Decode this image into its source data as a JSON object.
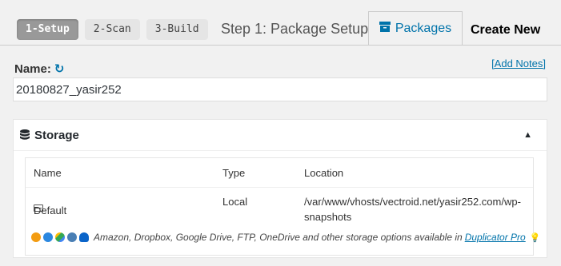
{
  "steps": [
    {
      "label": "1-Setup",
      "active": true
    },
    {
      "label": "2-Scan",
      "active": false
    },
    {
      "label": "3-Build",
      "active": false
    }
  ],
  "step_title": "Step 1: Package Setup",
  "tabs": {
    "packages_label": "Packages",
    "create_new_label": "Create New"
  },
  "name_section": {
    "label": "Name:",
    "add_notes": "[Add Notes]",
    "value": "20180827_yasir252"
  },
  "storage": {
    "title": "Storage",
    "columns": [
      "Name",
      "Type",
      "Location"
    ],
    "rows": [
      {
        "name": "Default",
        "type": "Local",
        "location": "/var/www/vhosts/vectroid.net/yasir252.com/wp-snapshots"
      }
    ],
    "promo_text": "Amazon, Dropbox, Google Drive, FTP, OneDrive and other storage options available in",
    "promo_link": "Duplicator Pro",
    "promo_icons": [
      {
        "name": "amazon-icon",
        "color": "#f39c12"
      },
      {
        "name": "dropbox-icon",
        "color": "#2c88e0"
      },
      {
        "name": "google-drive-icon",
        "color": "#34a853"
      },
      {
        "name": "ftp-icon",
        "color": "#4a7fb5"
      },
      {
        "name": "onedrive-icon",
        "color": "#0a64c9"
      }
    ]
  },
  "colors": {
    "accent": "#0073aa",
    "active_step": "#999999",
    "background": "#f1f1f1"
  }
}
